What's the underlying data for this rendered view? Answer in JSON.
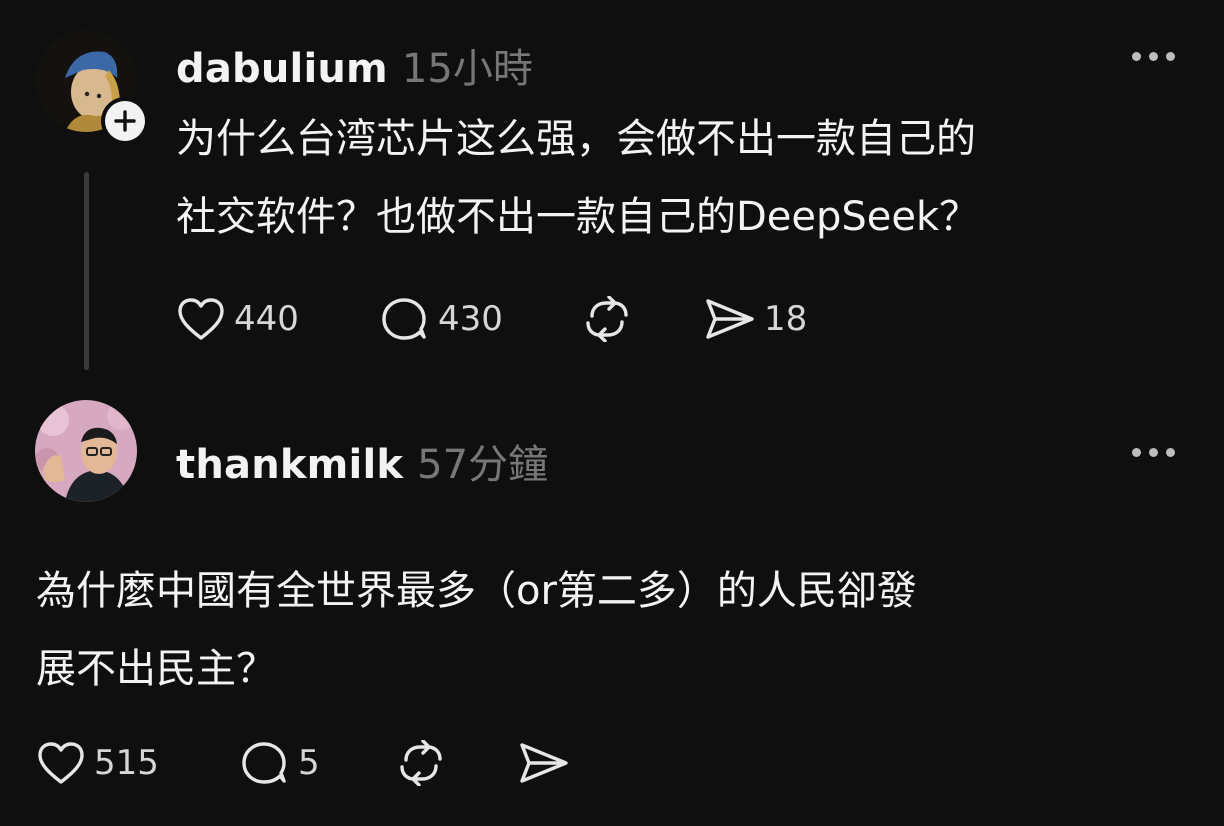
{
  "post1": {
    "username": "dabulium",
    "time": "15小時",
    "text_line1": "为什么台湾芯片这么强，会做不出一款自己的",
    "text_line2": "社交软件？也做不出一款自己的DeepSeek？",
    "likes": "440",
    "replies": "430",
    "shares": "18",
    "icons": [
      "heart-icon",
      "comment-icon",
      "repost-icon",
      "send-icon",
      "more-icon",
      "follow-plus-icon"
    ]
  },
  "post2": {
    "username": "thankmilk",
    "time": "57分鐘",
    "text_line1": "為什麼中國有全世界最多（or第二多）的人民卻發",
    "text_line2": "展不出民主？",
    "likes": "515",
    "replies": "5",
    "icons": [
      "heart-icon",
      "comment-icon",
      "repost-icon",
      "send-icon",
      "more-icon"
    ]
  },
  "colors": {
    "background": "#0f0f0f",
    "text": "#f3f3f3",
    "muted": "#777777",
    "thread_line": "#3a3a3a"
  }
}
